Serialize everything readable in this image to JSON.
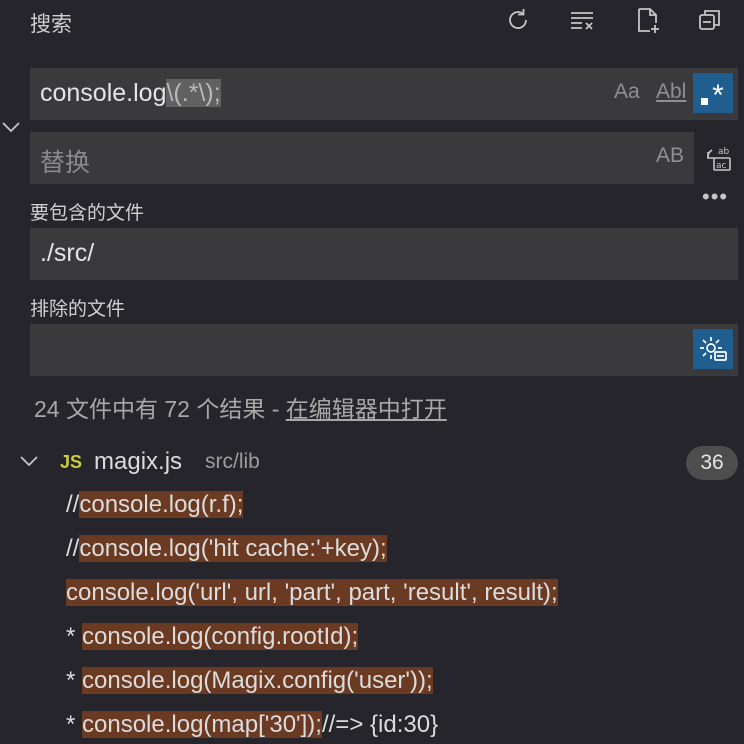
{
  "header": {
    "title": "搜索",
    "icons": [
      "refresh-icon",
      "clear-results-icon",
      "new-search-editor-icon",
      "collapse-all-icon"
    ]
  },
  "search": {
    "value_plain": "console.log",
    "value_regex": "\\(.*\\);",
    "opt_case": "Aa",
    "opt_word": "Abl",
    "opt_regex": "*"
  },
  "replace": {
    "placeholder": "替换",
    "opt_case": "AB"
  },
  "include": {
    "label": "要包含的文件",
    "value": "./src/"
  },
  "exclude": {
    "label": "排除的文件",
    "value": ""
  },
  "summary": {
    "text": "24 文件中有 72 个结果 - ",
    "link": "在编辑器中打开"
  },
  "file": {
    "lang": "JS",
    "name": "magix.js",
    "path": "src/lib",
    "count": "36"
  },
  "matches": [
    {
      "pre": "//",
      "hit": "console.log(r.f);",
      "post": ""
    },
    {
      "pre": "//",
      "hit": "console.log('hit cache:'+key);",
      "post": ""
    },
    {
      "pre": "",
      "hit": "console.log('url', url, 'part', part, 'result', result);",
      "post": ""
    },
    {
      "pre": "* ",
      "hit": "console.log(config.rootId);",
      "post": ""
    },
    {
      "pre": "* ",
      "hit": "console.log(Magix.config('user'));",
      "post": ""
    },
    {
      "pre": "* ",
      "hit": "console.log(map['30']);",
      "post": "//=> {id:30}"
    }
  ]
}
